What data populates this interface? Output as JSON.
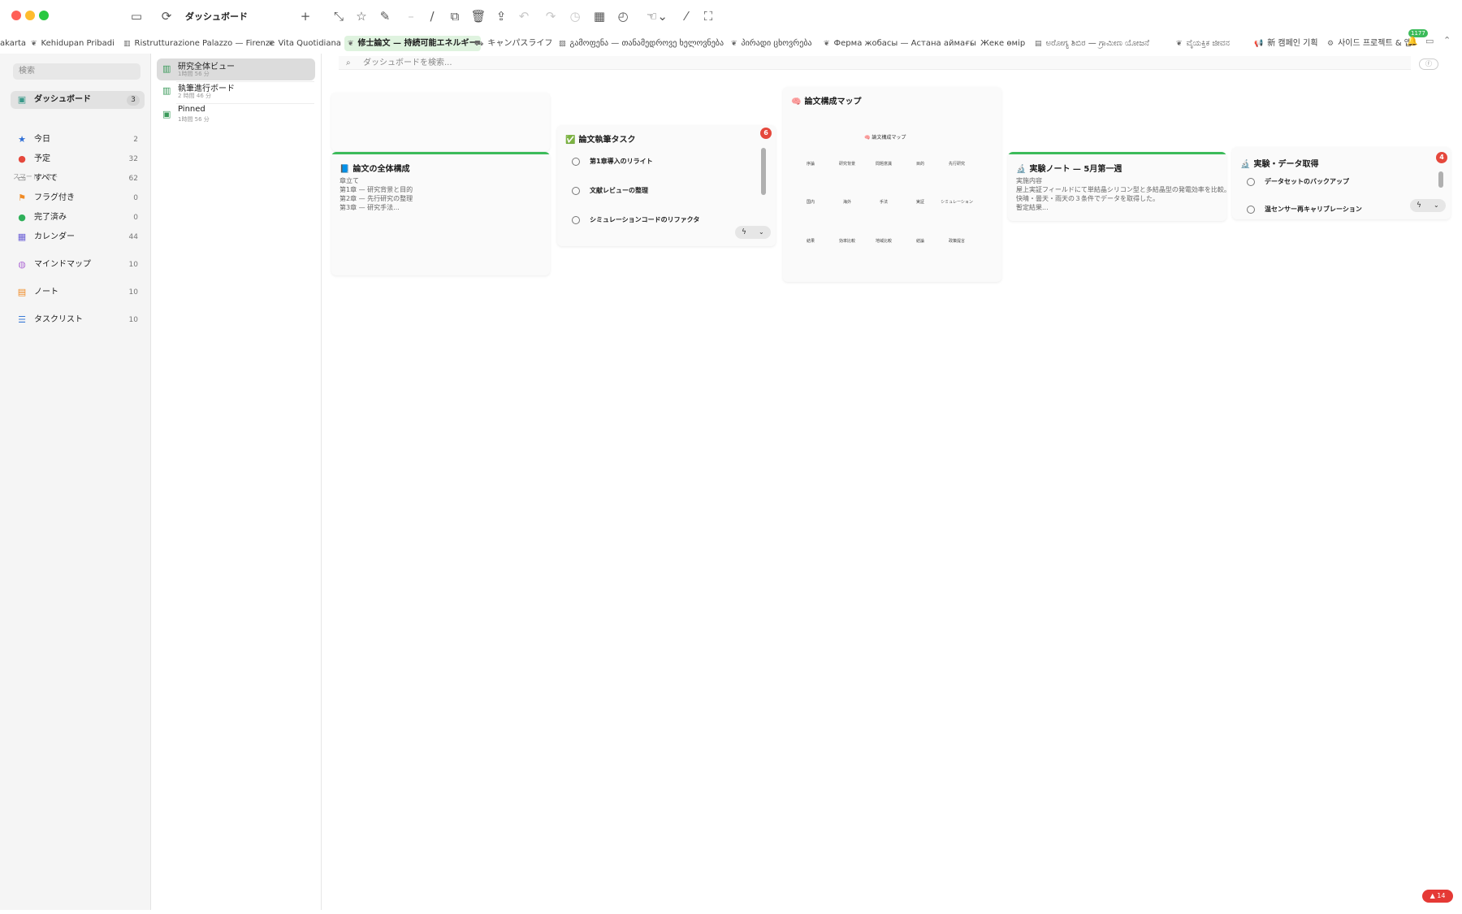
{
  "window": {
    "title": "ダッシュボード"
  },
  "toolbar": {
    "buttons": [
      "sidebar-toggle",
      "sync",
      "add",
      "expand",
      "star",
      "pin",
      "minus",
      "pen",
      "duplicate",
      "trash",
      "share",
      "undo",
      "redo",
      "history-clock",
      "layout",
      "history",
      "hand",
      "wand",
      "fullscreen"
    ]
  },
  "tabs": [
    {
      "icon": "",
      "label": "akarta"
    },
    {
      "icon": "leaf",
      "label": "Kehidupan Pribadi"
    },
    {
      "icon": "building",
      "label": "Ristrutturazione Palazzo — Firenze"
    },
    {
      "icon": "leaf",
      "label": "Vita Quotidiana"
    },
    {
      "icon": "leaf",
      "label": "修士論文 — 持続可能エネルギー",
      "active": true
    },
    {
      "icon": "car",
      "label": "キャンパスライフ"
    },
    {
      "icon": "image",
      "label": "გამოფენა — თანამედროვე ხელოვნება"
    },
    {
      "icon": "leaf",
      "label": "პირადი ცხოვრება"
    },
    {
      "icon": "leaf",
      "label": "Ферма жобасы — Астана аймағы"
    },
    {
      "icon": "moon",
      "label": "Жеке өмір"
    },
    {
      "icon": "book",
      "label": "ಅರೋಗ್ಯ ಶಿಬಿರ — ಗ್ರಾಮೀಣ ಯೋಜನೆ"
    },
    {
      "icon": "leaf",
      "label": "ವೈಯಕ್ತಿಕ ಜೀವನ"
    },
    {
      "icon": "megaphone",
      "label": "新 캠페인 기획"
    },
    {
      "icon": "gear",
      "label": "사이드 프로젝트 & 앱"
    }
  ],
  "notif_count": "1177",
  "sidebar": {
    "search_placeholder": "検索",
    "dashboard": {
      "label": "ダッシュボード",
      "count": "3"
    },
    "section": "スマートリスト",
    "items": [
      {
        "label": "今日",
        "count": "2",
        "icon": "star"
      },
      {
        "label": "予定",
        "count": "32",
        "icon": "calendar-alert"
      },
      {
        "label": "すべて",
        "count": "62",
        "icon": "tray"
      },
      {
        "label": "フラグ付き",
        "count": "0",
        "icon": "flag"
      },
      {
        "label": "完了済み",
        "count": "0",
        "icon": "check-circle"
      },
      {
        "label": "カレンダー",
        "count": "44",
        "icon": "calendar"
      }
    ],
    "extra": [
      {
        "label": "マインドマップ",
        "count": "10",
        "icon": "brain"
      },
      {
        "label": "ノート",
        "count": "10",
        "icon": "note"
      },
      {
        "label": "タスクリスト",
        "count": "10",
        "icon": "list"
      }
    ]
  },
  "dashboards": [
    {
      "title": "研究全体ビュー",
      "sub": "1時間 56 分"
    },
    {
      "title": "執筆進行ボード",
      "sub": "2 時間 46 分"
    },
    {
      "title": "Pinned",
      "sub": "1時間 56 分"
    }
  ],
  "main": {
    "search_placeholder": "ダッシュボードを検索...",
    "filter_label": "ⓕ"
  },
  "cards": {
    "overview": {
      "emoji": "📘",
      "title": "論文の全体構成",
      "lines": [
        "章立て",
        "第1章 — 研究背景と目的",
        "第2章 — 先行研究の整理",
        "第3章 — 研究手法..."
      ]
    },
    "tasks": {
      "emoji": "✅",
      "title": "論文執筆タスク",
      "badge": "6",
      "items": [
        "第1章導入のリライト",
        "文献レビューの整理",
        "シミュレーションコードのリファクタ"
      ]
    },
    "mindmap": {
      "emoji": "🧠",
      "title": "論文構成マップ",
      "center": "🧠 論文構成マップ",
      "rows": [
        [
          "序論",
          "研究背景",
          "問題意識",
          "目的",
          "先行研究"
        ],
        [
          "国内",
          "海外",
          "手法",
          "実証",
          "シミュレーション"
        ],
        [
          "結果",
          "効率比較",
          "地域比較",
          "結論",
          "政策提言"
        ]
      ]
    },
    "note": {
      "emoji": "🔬",
      "title": "実験ノート — 5月第一週",
      "lines": [
        "実施内容",
        "屋上実証フィールドにて単結晶シリコン型と多結晶型の発電効率を比較。",
        "快晴・曇天・雨天の３条件でデータを取得した。",
        "暫定結果..."
      ]
    },
    "data": {
      "emoji": "🔬",
      "title": "実験・データ取得",
      "badge": "4",
      "items": [
        "データセットのバックアップ",
        "温センサー再キャリブレーション"
      ]
    }
  },
  "corner_badge": "▲ 14"
}
